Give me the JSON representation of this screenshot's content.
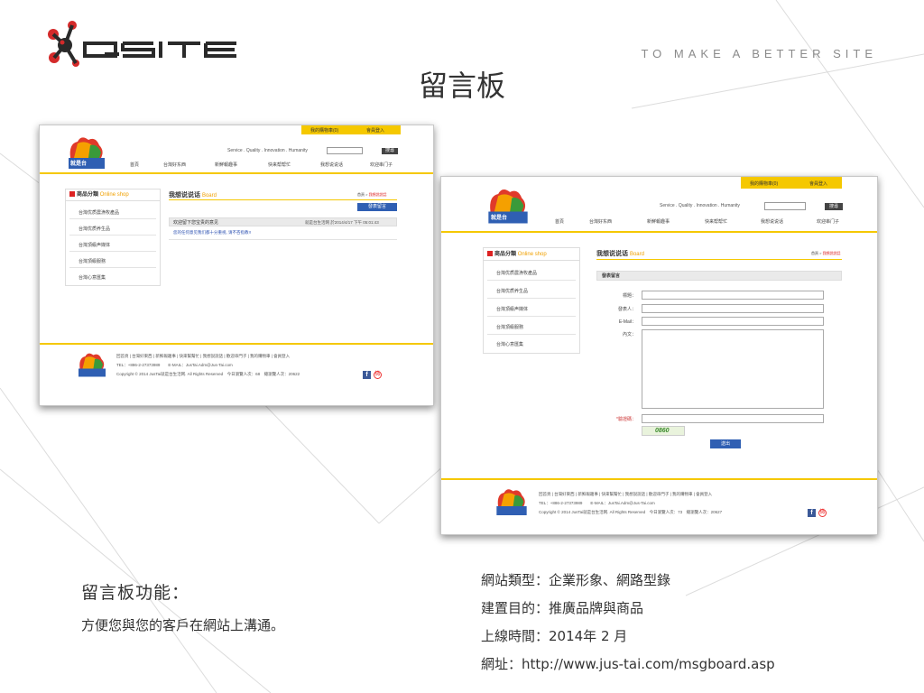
{
  "brand": {
    "logo_text": "QSITE",
    "tagline": "TO MAKE A BETTER SITE",
    "colors": {
      "red": "#d42a2a",
      "dark": "#2a2a2a",
      "accent": "#f5c800",
      "link_blue": "#2f5fb3"
    }
  },
  "page_title": "留言板",
  "site": {
    "logo_text": "就是台",
    "cart_label": "我的購物車(0)",
    "member_label": "會員登入",
    "slogan": "Service . Quality . Innovation . Humanity",
    "search_button": "搜尋",
    "nav": [
      "首頁",
      "台灣好东西",
      "新鮮報趣事",
      "快来帮帮忙",
      "我想说说话",
      "欢迎串门子"
    ],
    "sidebar_title": "商品分類",
    "sidebar_title_en": "Online shop",
    "categories": [
      "台灣优质農漁牧產品",
      "台灣优质养生品",
      "台灣頂級声媒体",
      "台灣頂級服務",
      "台灣心意匯集"
    ],
    "board_title": "我想说说话",
    "board_title_en": "Board",
    "breadcrumb_home": "首頁",
    "breadcrumb_current": "我想說說話",
    "post_button": "發表留言",
    "message": {
      "title": "欢迎留下您宝贵的意见",
      "time": "就是台生活网 於2014/4/17 下午 05:01:43",
      "body": "您的任何意见我们都十分重视, 请不吝指教!!"
    },
    "form": {
      "section_title": "發表留言",
      "labels": [
        "標題：",
        "發表人：",
        "E-Mail：",
        "內文："
      ],
      "captcha_label": "*驗證碼：",
      "captcha_value": "0860",
      "submit": "送出"
    },
    "footer": {
      "links": "回首頁 | 台灣好東西 | 新鮮報趣事 | 快來幫幫忙 | 我想說說話 | 歡迎串門子 | 我的購物車 | 會員登入",
      "contact": "TEL：+886-2-27373989　　E-MAIL：JusTai.Adm@Jus-Tai.com",
      "copyright_1": "Copyright © 2014 JusTai就是台生活网. All Rights Reserved　今日瀏覽人次：68　總瀏覽人次：20622",
      "copyright_2": "Copyright © 2014 JusTai就是台生活网. All Rights Reserved　今日瀏覽人次：73　總瀏覽人次：20627",
      "facebook_icon": "f",
      "weibo_icon": "微"
    }
  },
  "feature": {
    "title": "留言板功能：",
    "desc": "方便您與您的客戶在網站上溝通。"
  },
  "info": {
    "type": "網站類型：企業形象、網路型錄",
    "purpose": "建置目的：推廣品牌與商品",
    "launch": "上線時間：2014年 2 月",
    "url": "網址：http://www.jus-tai.com/msgboard.asp"
  }
}
